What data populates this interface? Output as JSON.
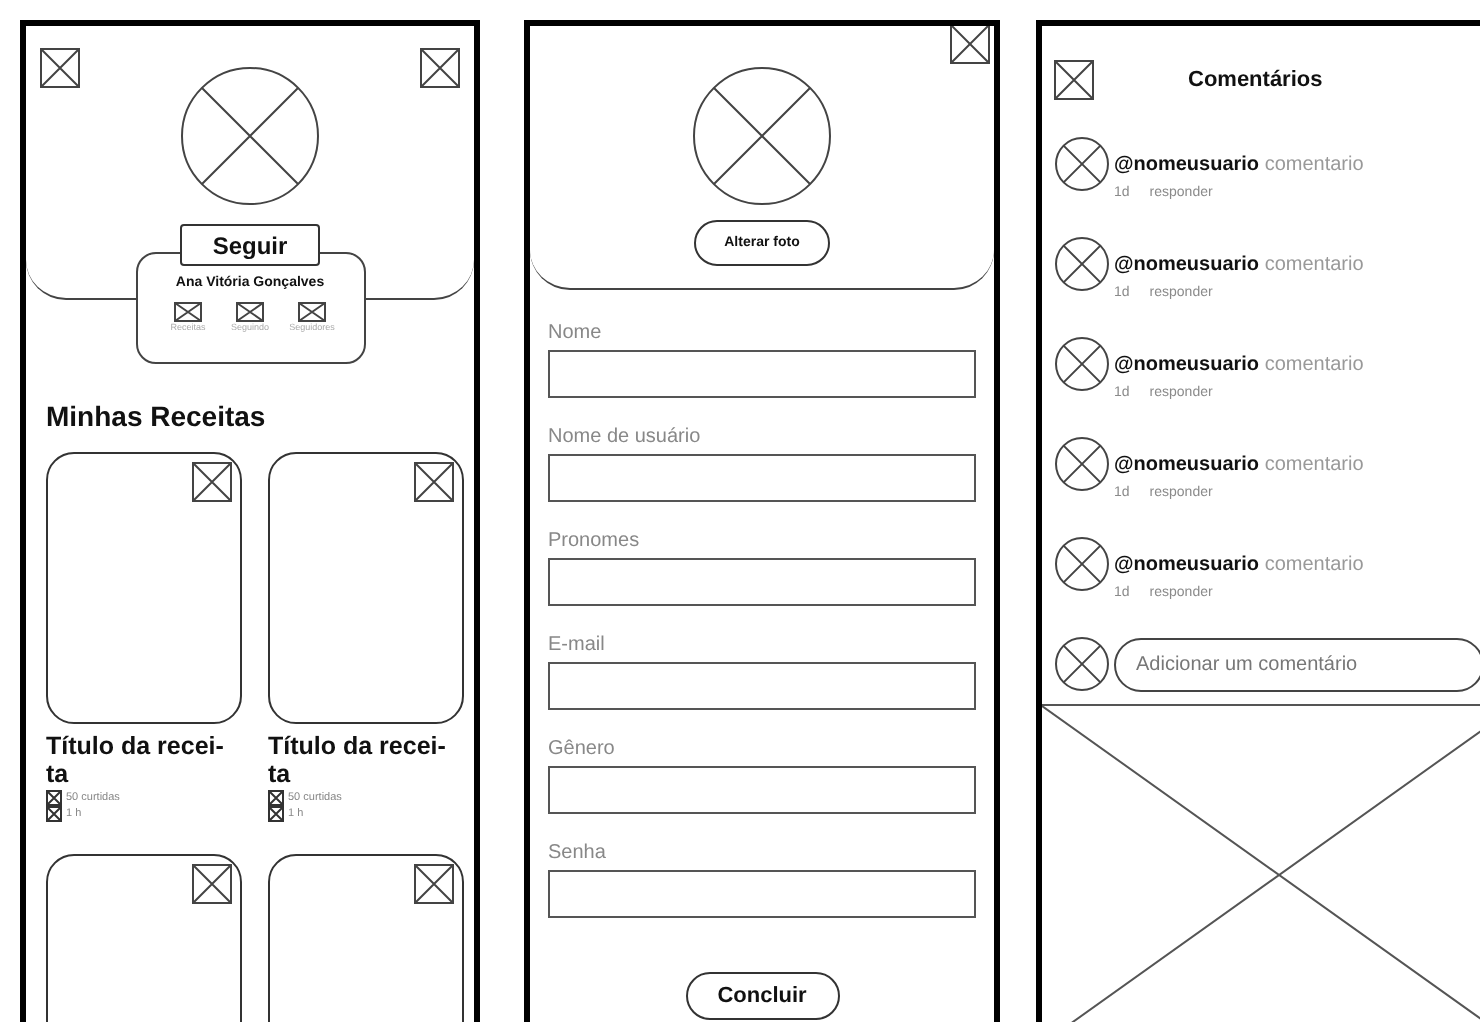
{
  "profile_screen": {
    "follow_button": "Seguir",
    "name": "Ana Vitória Gonçalves",
    "stats": [
      {
        "label": "Receitas"
      },
      {
        "label": "Seguindo"
      },
      {
        "label": "Seguidores"
      }
    ],
    "section_title": "Minhas Receitas",
    "recipes": [
      {
        "kind": "full",
        "title": "Título da recei-ta",
        "likes": "50 curtidas",
        "time": "1 h"
      },
      {
        "kind": "full",
        "title": "Título da recei-ta",
        "likes": "50 curtidas",
        "time": "1 h"
      },
      {
        "kind": "image-only"
      },
      {
        "kind": "image-only"
      }
    ]
  },
  "edit_screen": {
    "change_photo_button": "Alterar foto",
    "fields": [
      {
        "label": "Nome"
      },
      {
        "label": "Nome de usuário"
      },
      {
        "label": "Pronomes"
      },
      {
        "label": "E-mail"
      },
      {
        "label": "Gênero"
      },
      {
        "label": "Senha"
      }
    ],
    "submit_button": "Concluir"
  },
  "comments_screen": {
    "title": "Comentários",
    "comments": [
      {
        "text": "**@nomeusuario** comentario",
        "age": "1d",
        "reply": "responder"
      },
      {
        "text": "**@nomeusuario** comentario",
        "age": "1d",
        "reply": "responder"
      },
      {
        "text": "**@nomeusuario** comentario",
        "age": "1d",
        "reply": "responder"
      },
      {
        "text": "**@nomeusuario** comentario",
        "age": "1d",
        "reply": "responder"
      },
      {
        "text": "**@nomeusuario** comentario",
        "age": "1d",
        "reply": "responder"
      }
    ],
    "input": {
      "placeholder": "Adicionar um comentário"
    }
  }
}
